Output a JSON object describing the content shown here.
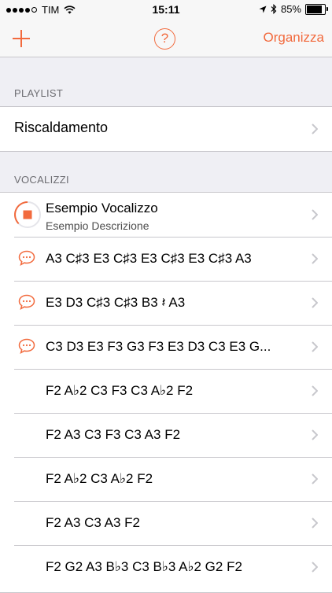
{
  "status_bar": {
    "carrier": "TIM",
    "time": "15:11",
    "battery": "85%",
    "battery_level": 0.85
  },
  "navbar": {
    "add_icon": "plus-icon",
    "help_label": "?",
    "organize_label": "Organizza"
  },
  "playlist": {
    "header": "PLAYLIST",
    "items": [
      {
        "label": "Riscaldamento"
      }
    ]
  },
  "vocalizzi": {
    "header": "VOCALIZZI",
    "items": [
      {
        "title": "Esempio Vocalizzo",
        "subtitle": "Esempio Descrizione",
        "icon": "stop-icon"
      },
      {
        "title": "A3 C♯3 E3 C♯3 E3 C♯3 E3 C♯3 A3",
        "icon": "speech-bubble-icon"
      },
      {
        "title": "E3 D3 C♯3 C♯3 B3 𝄽 A3",
        "icon": "speech-bubble-icon"
      },
      {
        "title": "C3 D3 E3 F3 G3 F3 E3 D3 C3 E3 G...",
        "icon": "speech-bubble-icon"
      },
      {
        "title": "F2 A♭2 C3 F3 C3 A♭2 F2"
      },
      {
        "title": "F2 A3 C3 F3 C3 A3 F2"
      },
      {
        "title": "F2 A♭2 C3 A♭2 F2"
      },
      {
        "title": "F2 A3 C3 A3 F2"
      },
      {
        "title": "F2 G2 A3 B♭3 C3 B♭3 A♭2 G2 F2"
      }
    ]
  },
  "colors": {
    "accent": "#f26a3d",
    "background": "#efeff4",
    "separator": "#c8c7cc"
  }
}
